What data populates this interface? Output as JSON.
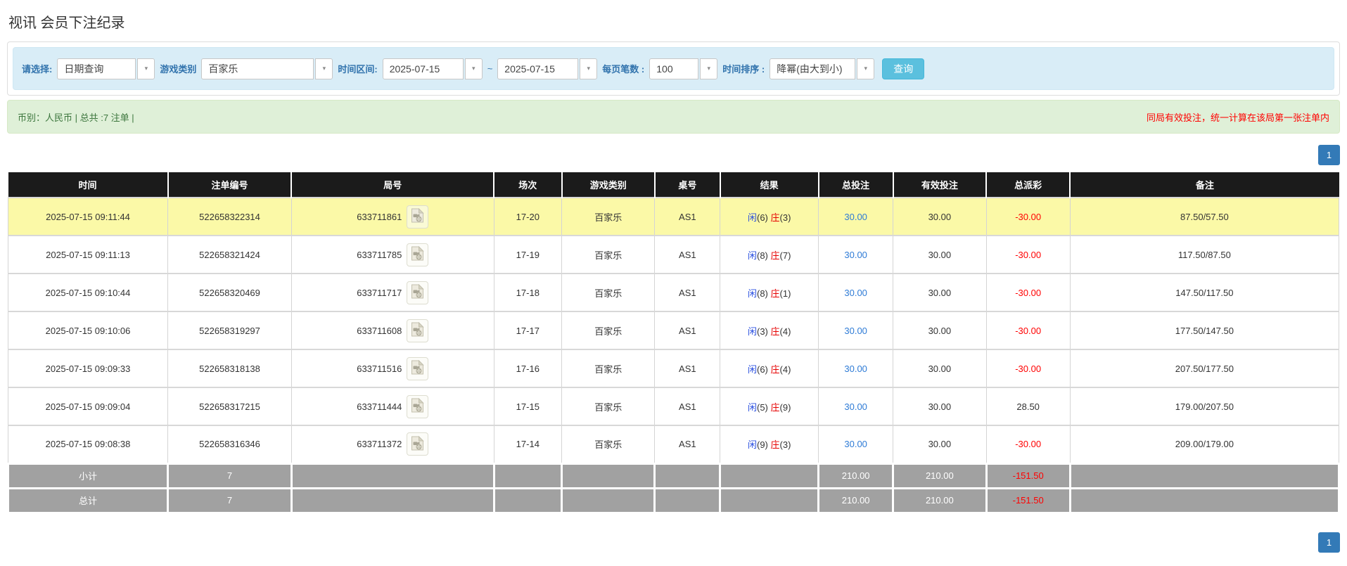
{
  "page": {
    "title": "视讯 会员下注纪录"
  },
  "filters": {
    "select_label": "请选择:",
    "select_value": "日期查询",
    "game_label": "游戏类别",
    "game_value": "百家乐",
    "range_label": "时间区间:",
    "range_from": "2025-07-15",
    "range_tilde": "~",
    "range_to": "2025-07-15",
    "page_size_label": "每页笔数 :",
    "page_size_value": "100",
    "sort_label": "时间排序 :",
    "sort_value": "降幂(由大到小)",
    "search_button": "查询"
  },
  "summary": {
    "currency_info": "币别：人民币 | 总共 :7 注单 |",
    "note": "同局有效投注，统一计算在该局第一张注单内"
  },
  "pagination": {
    "top": "1",
    "bottom": "1"
  },
  "icons": {
    "dropdown_arrow": "▾",
    "video_replay": "video-replay-icon"
  },
  "table": {
    "headers": [
      "时间",
      "注单编号",
      "局号",
      "场次",
      "游戏类别",
      "桌号",
      "结果",
      "总投注",
      "有效投注",
      "总派彩",
      "备注"
    ],
    "rows": [
      {
        "time": "2025-07-15 09:11:44",
        "bet_id": "522658322314",
        "round_id": "633711861",
        "session": "17-20",
        "game": "百家乐",
        "table_no": "AS1",
        "result_player": "闲",
        "result_player_pts": "(6)",
        "result_banker": "庄",
        "result_banker_pts": "(3)",
        "total_bet": "30.00",
        "valid_bet": "30.00",
        "payout": "-30.00",
        "remark": "87.50/57.50",
        "highlight": true
      },
      {
        "time": "2025-07-15 09:11:13",
        "bet_id": "522658321424",
        "round_id": "633711785",
        "session": "17-19",
        "game": "百家乐",
        "table_no": "AS1",
        "result_player": "闲",
        "result_player_pts": "(8)",
        "result_banker": "庄",
        "result_banker_pts": "(7)",
        "total_bet": "30.00",
        "valid_bet": "30.00",
        "payout": "-30.00",
        "remark": "117.50/87.50",
        "highlight": false
      },
      {
        "time": "2025-07-15 09:10:44",
        "bet_id": "522658320469",
        "round_id": "633711717",
        "session": "17-18",
        "game": "百家乐",
        "table_no": "AS1",
        "result_player": "闲",
        "result_player_pts": "(8)",
        "result_banker": "庄",
        "result_banker_pts": "(1)",
        "total_bet": "30.00",
        "valid_bet": "30.00",
        "payout": "-30.00",
        "remark": "147.50/117.50",
        "highlight": false
      },
      {
        "time": "2025-07-15 09:10:06",
        "bet_id": "522658319297",
        "round_id": "633711608",
        "session": "17-17",
        "game": "百家乐",
        "table_no": "AS1",
        "result_player": "闲",
        "result_player_pts": "(3)",
        "result_banker": "庄",
        "result_banker_pts": "(4)",
        "total_bet": "30.00",
        "valid_bet": "30.00",
        "payout": "-30.00",
        "remark": "177.50/147.50",
        "highlight": false
      },
      {
        "time": "2025-07-15 09:09:33",
        "bet_id": "522658318138",
        "round_id": "633711516",
        "session": "17-16",
        "game": "百家乐",
        "table_no": "AS1",
        "result_player": "闲",
        "result_player_pts": "(6)",
        "result_banker": "庄",
        "result_banker_pts": "(4)",
        "total_bet": "30.00",
        "valid_bet": "30.00",
        "payout": "-30.00",
        "remark": "207.50/177.50",
        "highlight": false
      },
      {
        "time": "2025-07-15 09:09:04",
        "bet_id": "522658317215",
        "round_id": "633711444",
        "session": "17-15",
        "game": "百家乐",
        "table_no": "AS1",
        "result_player": "闲",
        "result_player_pts": "(5)",
        "result_banker": "庄",
        "result_banker_pts": "(9)",
        "total_bet": "30.00",
        "valid_bet": "30.00",
        "payout": "28.50",
        "remark": "179.00/207.50",
        "highlight": false
      },
      {
        "time": "2025-07-15 09:08:38",
        "bet_id": "522658316346",
        "round_id": "633711372",
        "session": "17-14",
        "game": "百家乐",
        "table_no": "AS1",
        "result_player": "闲",
        "result_player_pts": "(9)",
        "result_banker": "庄",
        "result_banker_pts": "(3)",
        "total_bet": "30.00",
        "valid_bet": "30.00",
        "payout": "-30.00",
        "remark": "209.00/179.00",
        "highlight": false
      }
    ],
    "subtotal": {
      "label": "小计",
      "count": "7",
      "total_bet": "210.00",
      "valid_bet": "210.00",
      "payout": "-151.50"
    },
    "grand_total": {
      "label": "总计",
      "count": "7",
      "total_bet": "210.00",
      "valid_bet": "210.00",
      "payout": "-151.50"
    }
  }
}
